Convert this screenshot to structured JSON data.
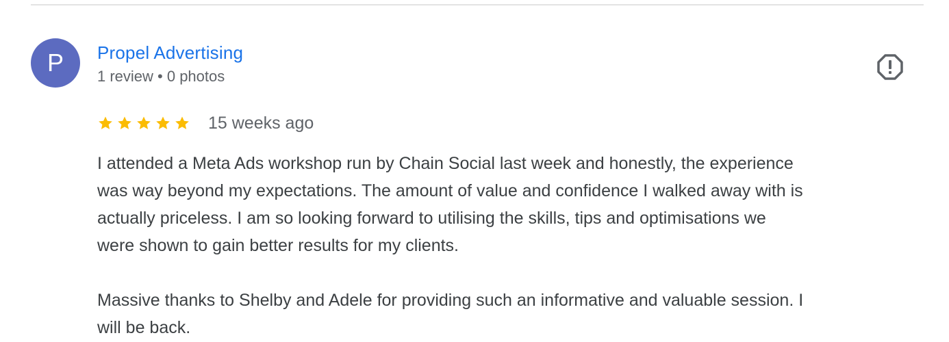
{
  "review": {
    "avatar_letter": "P",
    "avatar_color": "#5c6bc0",
    "author_name": "Propel Advertising",
    "author_meta": "1 review • 0 photos",
    "rating": 5,
    "rating_max": 5,
    "star_color": "#fbbc04",
    "time_ago": "15 weeks ago",
    "text": "I attended a Meta Ads workshop run by Chain Social last week and honestly, the experience\nwas way beyond my expectations. The amount of value and confidence I walked away with is\nactually priceless. I am so looking forward to utilising the skills, tips and optimisations we\nwere shown to gain better results for my clients.\n\nMassive thanks to Shelby and Adele for providing such an informative and valuable session. I\nwill be back.",
    "report_icon": "report-flag-icon"
  }
}
